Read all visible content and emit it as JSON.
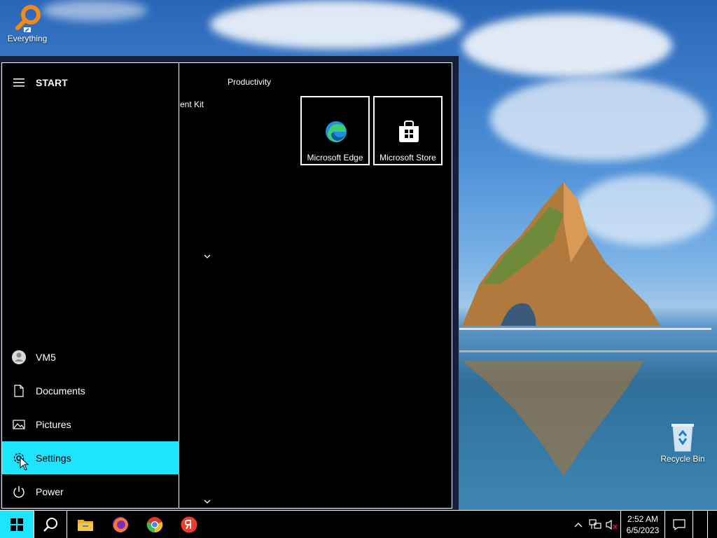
{
  "desktop": {
    "icons": [
      {
        "label": "Everything"
      },
      {
        "label": "Recycle Bin"
      }
    ]
  },
  "start_menu": {
    "title": "START",
    "partial_app_text": "ent Kit",
    "group_title": "Productivity",
    "nav_items": [
      {
        "label": "VM5",
        "icon": "user-icon"
      },
      {
        "label": "Documents",
        "icon": "document-icon"
      },
      {
        "label": "Pictures",
        "icon": "pictures-icon"
      },
      {
        "label": "Settings",
        "icon": "gear-icon"
      },
      {
        "label": "Power",
        "icon": "power-icon"
      }
    ],
    "tiles": [
      {
        "label": "Microsoft Edge",
        "icon": "edge-icon"
      },
      {
        "label": "Microsoft Store",
        "icon": "store-icon"
      }
    ]
  },
  "taskbar": {
    "pinned": [
      "file-explorer-icon",
      "firefox-icon",
      "chrome-icon",
      "yandex-icon"
    ],
    "clock": {
      "time": "2:52 AM",
      "date": "6/5/2023"
    }
  },
  "colors": {
    "accent": "#1de5ff",
    "background": "#000000",
    "text": "#ffffff"
  }
}
